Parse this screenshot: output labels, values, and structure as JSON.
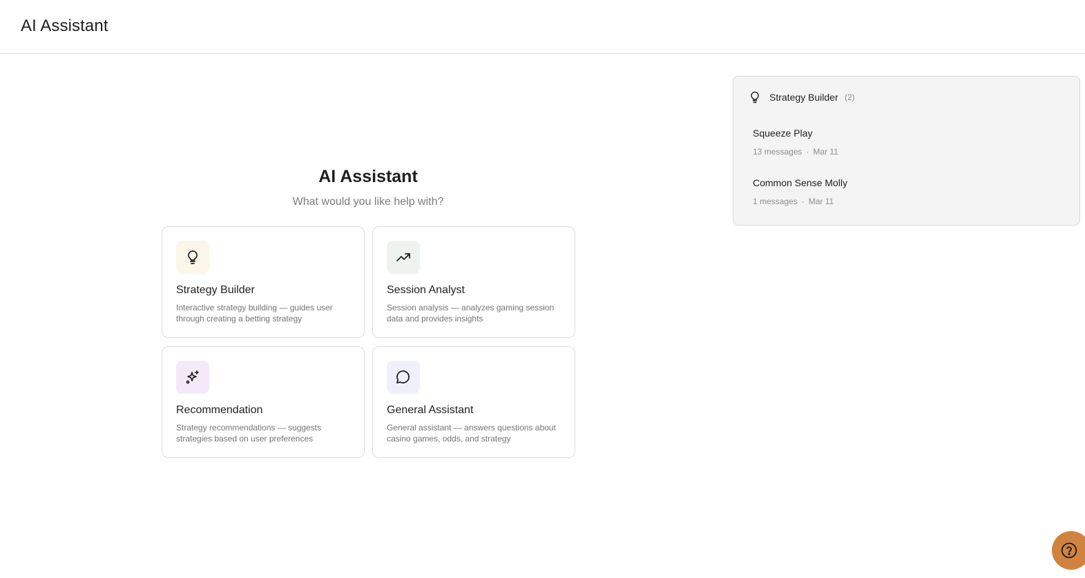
{
  "header": {
    "title": "AI Assistant"
  },
  "hero": {
    "title": "AI Assistant",
    "subtitle": "What would you like help with?"
  },
  "cards": [
    {
      "title": "Strategy Builder",
      "description": "Interactive strategy building — guides user through creating a betting strategy",
      "icon": "lightbulb-icon",
      "icon_bg": "#fcf6ea"
    },
    {
      "title": "Session Analyst",
      "description": "Session analysis — analyzes gaming session data and provides insights",
      "icon": "trending-up-icon",
      "icon_bg": "#eef3ef"
    },
    {
      "title": "Recommendation",
      "description": "Strategy recommendations — suggests strategies based on user preferences",
      "icon": "sparkles-icon",
      "icon_bg": "#f3e9f8"
    },
    {
      "title": "General Assistant",
      "description": "General assistant — answers questions about casino games, odds, and strategy",
      "icon": "chat-bubble-icon",
      "icon_bg": "#eff0fa"
    }
  ],
  "history": {
    "title": "Strategy Builder",
    "count": "(2)",
    "icon": "lightbulb-icon",
    "conversations": [
      {
        "title": "Squeeze Play",
        "messages": "13 messages",
        "date": "Mar 11"
      },
      {
        "title": "Common Sense Molly",
        "messages": "1 messages",
        "date": "Mar 11"
      }
    ]
  },
  "help": {
    "icon": "question-icon",
    "color": "#d0833f"
  }
}
